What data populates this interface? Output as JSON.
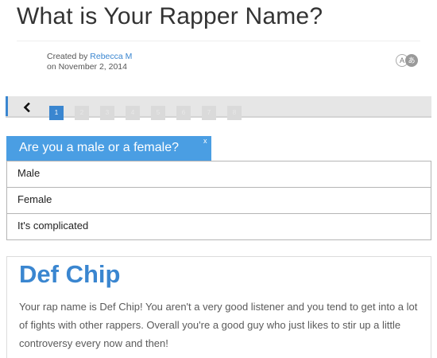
{
  "quiz": {
    "title": "What is Your Rapper Name?",
    "created_by_prefix": "Created by",
    "author": "Rebecca M",
    "date": "on November 2, 2014",
    "lang_toggle": {
      "a": "A",
      "b": "あ"
    }
  },
  "navigation": {
    "back_icon": "chevron-left-icon",
    "pages": [
      "1",
      "2",
      "3",
      "4",
      "5",
      "6",
      "7",
      "8"
    ],
    "current_page": "1"
  },
  "question": {
    "text": "Are you a male or a female?",
    "close": "x",
    "answers": [
      "Male",
      "Female",
      "It's complicated"
    ]
  },
  "result": {
    "title": "Def Chip",
    "description": "Your rap name is Def Chip! You aren't a very good listener and you tend to get into a lot of fights with other rappers. Overall you're a good guy who just likes to stir up a little controversy every now and then!"
  },
  "colors": {
    "accent": "#3a86d0",
    "question_bg": "#4a9ee3",
    "progress_bg": "#e6e6e6"
  }
}
